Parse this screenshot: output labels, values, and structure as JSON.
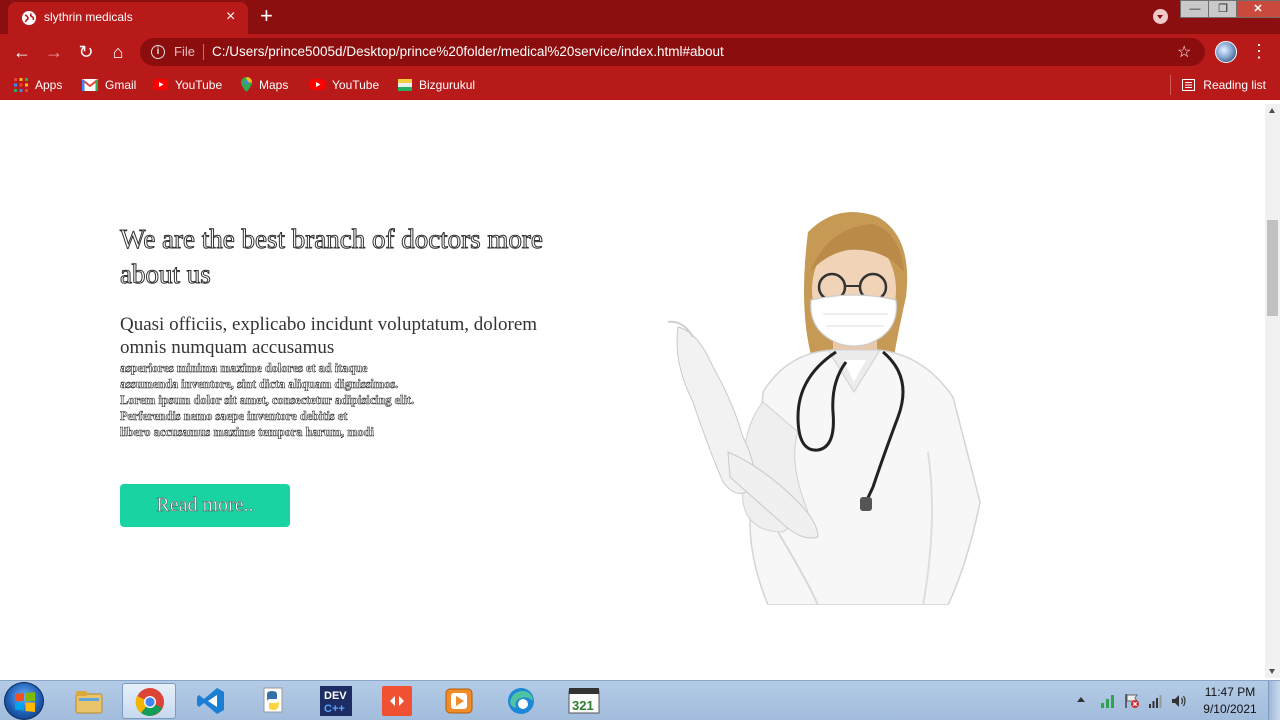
{
  "browser": {
    "tab": {
      "title": "slythrin medicals",
      "close_label": "×"
    },
    "new_tab_label": "+",
    "window_controls": {
      "minimize": "—",
      "maximize": "❐",
      "close": "✕"
    },
    "toolbar": {
      "back_label": "←",
      "forward_label": "→",
      "reload_label": "↻",
      "home_label": "⌂",
      "file_label": "File",
      "url": "C:/Users/prince5005d/Desktop/prince%20folder/medical%20service/index.html#about",
      "star_label": "☆",
      "menu_label": "⋮"
    },
    "bookmarks": [
      {
        "label": "Apps",
        "icon": "apps-grid-icon"
      },
      {
        "label": "Gmail",
        "icon": "gmail-icon"
      },
      {
        "label": "YouTube",
        "icon": "youtube-icon"
      },
      {
        "label": "Maps",
        "icon": "maps-icon"
      },
      {
        "label": "YouTube",
        "icon": "youtube-icon"
      },
      {
        "label": "Bizgurukul",
        "icon": "bizgurukul-icon"
      }
    ],
    "reading_list_label": "Reading list"
  },
  "about": {
    "heading": "We are the best branch of doctors more about us",
    "subheading": "Quasi officiis, explicabo incidunt voluptatum, dolorem omnis numquam accusamus",
    "body": "asperiores minima maxime dolores et ad itaque\nassumenda inventore, sint dicta aliquam dignissimos.\nLorem ipsum dolor sit amet, consectetur adipisicing elit.\nPerferendis nemo saepe inventore debitis et\nlibero accusamus maxime tempora harum, modi",
    "button_label": "Read more..",
    "image": "doctor-with-mask-and-stethoscope"
  },
  "taskbar": {
    "apps": [
      "file-explorer-icon",
      "chrome-icon",
      "vscode-icon",
      "python-icon",
      "devcpp-icon",
      "git-icon",
      "media-player-icon",
      "edge-icon",
      "321-player-icon"
    ],
    "clock": {
      "time": "11:47 PM",
      "date": "9/10/2021"
    }
  },
  "colors": {
    "browser_frame": "#8b0f0f",
    "browser_toolbar": "#b81a1a",
    "accent_button": "#19d3a2"
  }
}
